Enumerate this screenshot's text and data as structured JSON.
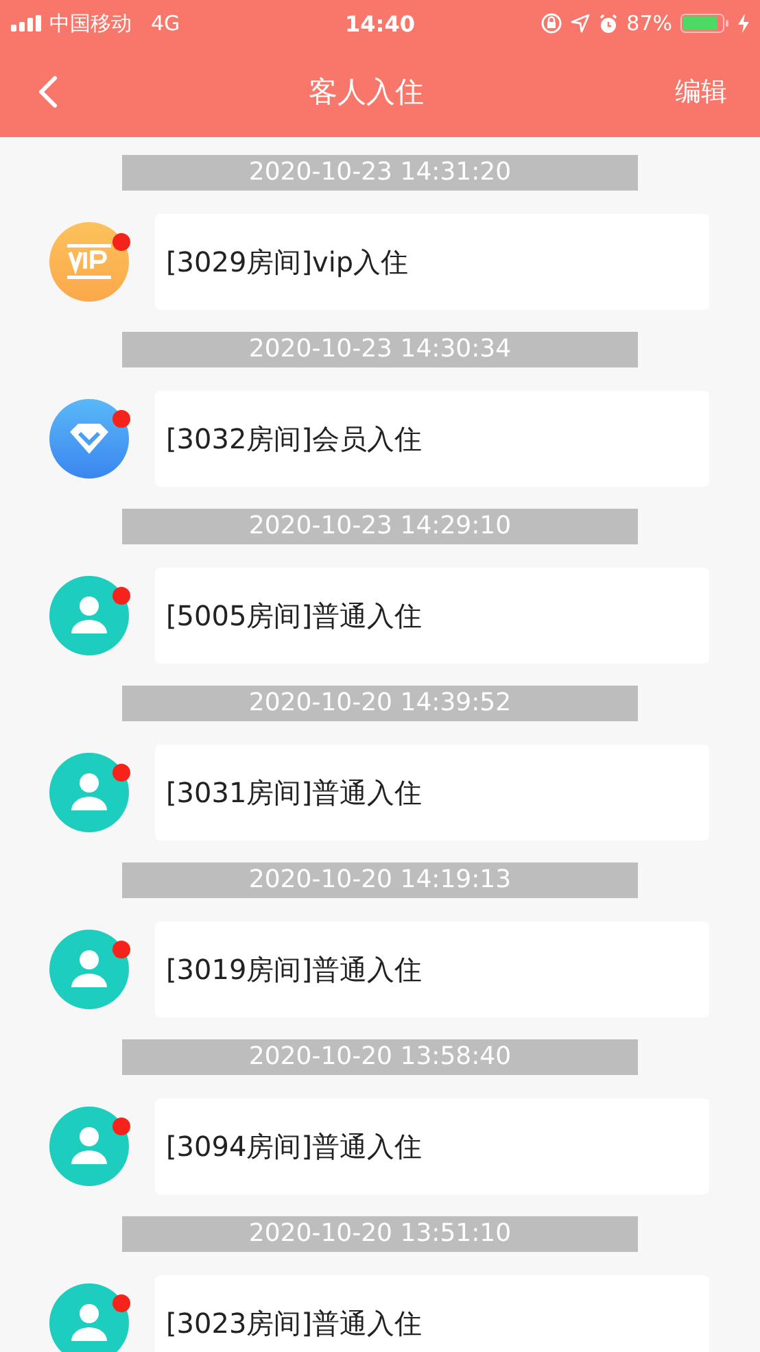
{
  "status_bar": {
    "carrier": "中国移动",
    "network": "4G",
    "time": "14:40",
    "battery": "87%"
  },
  "nav": {
    "title": "客人入住",
    "action": "编辑"
  },
  "messages": [
    {
      "time": "2020-10-23 14:31:20",
      "kind": "vip",
      "text": "[3029房间]vip入住",
      "unread": true
    },
    {
      "time": "2020-10-23 14:30:34",
      "kind": "member",
      "text": "[3032房间]会员入住",
      "unread": true
    },
    {
      "time": "2020-10-23 14:29:10",
      "kind": "normal",
      "text": "[5005房间]普通入住",
      "unread": true
    },
    {
      "time": "2020-10-20 14:39:52",
      "kind": "normal",
      "text": "[3031房间]普通入住",
      "unread": true
    },
    {
      "time": "2020-10-20 14:19:13",
      "kind": "normal",
      "text": "[3019房间]普通入住",
      "unread": true
    },
    {
      "time": "2020-10-20 13:58:40",
      "kind": "normal",
      "text": "[3094房间]普通入住",
      "unread": true
    },
    {
      "time": "2020-10-20 13:51:10",
      "kind": "normal",
      "text": "[3023房间]普通入住",
      "unread": true
    }
  ]
}
